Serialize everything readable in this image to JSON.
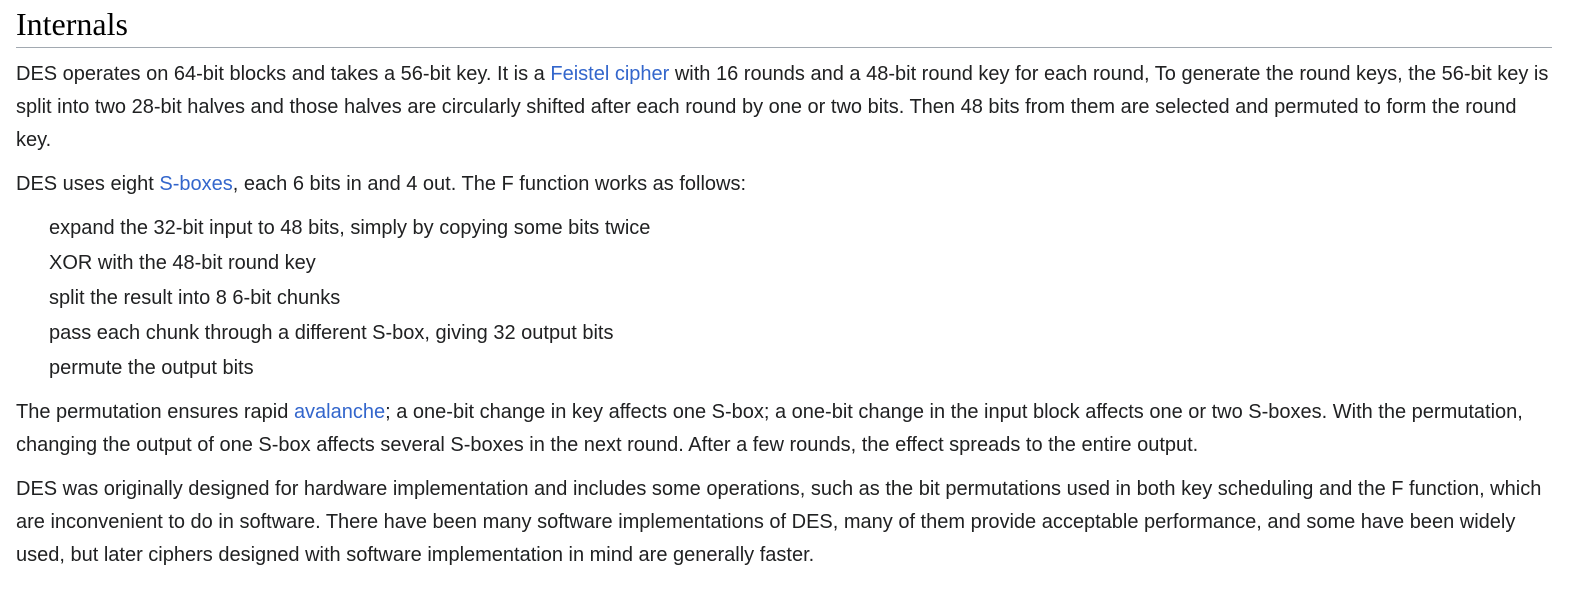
{
  "section": {
    "heading": "Internals"
  },
  "p1": {
    "t1": "DES operates on 64-bit blocks and takes a 56-bit key. It is a ",
    "link": "Feistel cipher",
    "t2": " with 16 rounds and a 48-bit round key for each round, To generate the round keys, the 56-bit key is split into two 28-bit halves and those halves are circularly shifted after each round by one or two bits. Then 48 bits from them are selected and permuted to form the round key."
  },
  "p2": {
    "t1": "DES uses eight ",
    "link": "S-boxes",
    "t2": ", each 6 bits in and 4 out. The F function works as follows:"
  },
  "steps": [
    "expand the 32-bit input to 48 bits, simply by copying some bits twice",
    "XOR with the 48-bit round key",
    "split the result into 8 6-bit chunks",
    "pass each chunk through a different S-box, giving 32 output bits",
    "permute the output bits"
  ],
  "p3": {
    "t1": "The permutation ensures rapid ",
    "link": "avalanche",
    "t2": "; a one-bit change in key affects one S-box; a one-bit change in the input block affects one or two S-boxes. With the permutation, changing the output of one S-box affects several S-boxes in the next round. After a few rounds, the effect spreads to the entire output."
  },
  "p4": {
    "text": "DES was originally designed for hardware implementation and includes some operations, such as the bit permutations used in both key scheduling and the F function, which are inconvenient to do in software. There have been many software implementations of DES, many of them provide acceptable performance, and some have been widely used, but later ciphers designed with software implementation in mind are generally faster."
  },
  "colors": {
    "text": "#202122",
    "link": "#3366cc",
    "rule": "#a2a9b1"
  }
}
